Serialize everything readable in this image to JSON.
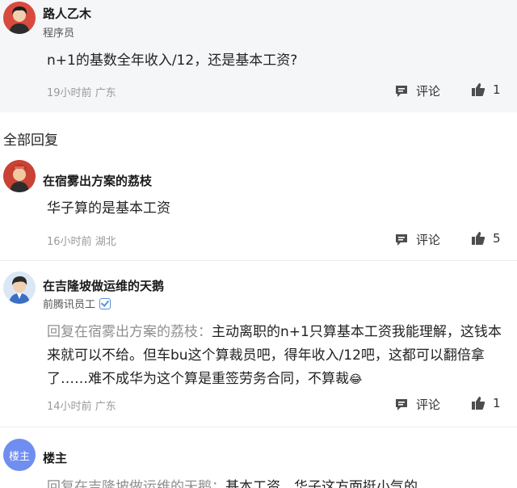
{
  "post": {
    "user": "路人乙木",
    "title": "程序员",
    "text": "n+1的基数全年收入/12，还是基本工资?",
    "time": "19小时前",
    "location": "广东",
    "comment_label": "评论",
    "likes": "1"
  },
  "section_title": "全部回复",
  "replies": [
    {
      "user": "在宿雾出方案的荔枝",
      "text": "华子算的是基本工资",
      "time": "16小时前",
      "location": "湖北",
      "comment_label": "评论",
      "likes": "5"
    },
    {
      "user": "在吉隆坡做运维的天鹅",
      "title": "前腾讯员工",
      "reply_prefix": "回复在宿雾出方案的荔枝：",
      "text": "主动离职的n+1只算基本工资我能理解，这钱本来就可以不给。但车bu这个算裁员吧，得年收入/12吧，这都可以翻倍拿了……难不成华为这个算是重签劳务合同，不算裁",
      "emoji": "😂",
      "time": "14小时前",
      "location": "广东",
      "comment_label": "评论",
      "likes": "1"
    },
    {
      "user": "楼主",
      "avatar_text": "楼主",
      "reply_prefix": "回复在吉隆坡做运维的天鹅：",
      "text": "基本工资，华子这方面挺小气的"
    }
  ],
  "colors": {
    "post_background": "#f5f6f8",
    "meta": "#9a9a9a",
    "op_avatar": "#6f8ef0"
  }
}
